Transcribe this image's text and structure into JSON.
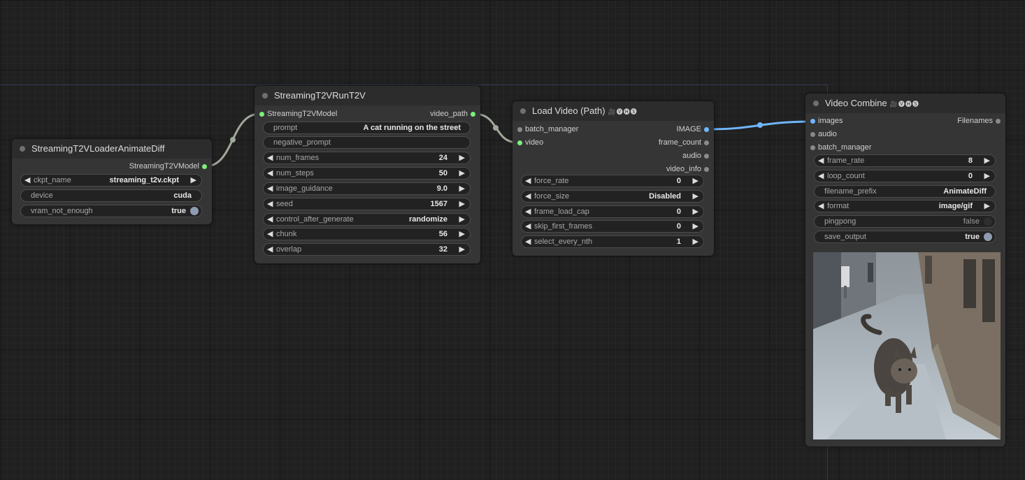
{
  "colors": {
    "link_green": "#a0a89a",
    "link_blue": "#6fb7ff",
    "slot_green": "#7cf07c",
    "slot_blue": "#6fb7ff",
    "slot_grey": "#8a8a8a",
    "toggle_on": "#8e9bb0"
  },
  "loader": {
    "title": "StreamingT2VLoaderAnimateDiff",
    "output": "StreamingT2VModel",
    "widgets": [
      {
        "name": "ckpt_name",
        "value": "streaming_t2v.ckpt"
      },
      {
        "name": "device",
        "value": "cuda"
      },
      {
        "name": "vram_not_enough",
        "value": "true"
      }
    ]
  },
  "run": {
    "title": "StreamingT2VRunT2V",
    "input": "StreamingT2VModel",
    "output": "video_path",
    "widgets": [
      {
        "name": "prompt",
        "value": "A cat running on the street"
      },
      {
        "name": "negative_prompt",
        "value": ""
      },
      {
        "name": "num_frames",
        "value": "24"
      },
      {
        "name": "num_steps",
        "value": "50"
      },
      {
        "name": "image_guidance",
        "value": "9.0"
      },
      {
        "name": "seed",
        "value": "1567"
      },
      {
        "name": "control_after_generate",
        "value": "randomize"
      },
      {
        "name": "chunk",
        "value": "56"
      },
      {
        "name": "overlap",
        "value": "32"
      }
    ]
  },
  "load": {
    "title": "Load Video (Path)",
    "badge": "🎥🅥🅗🅢",
    "inputs": [
      "batch_manager",
      "video"
    ],
    "outputs": [
      "IMAGE",
      "frame_count",
      "audio",
      "video_info"
    ],
    "widgets": [
      {
        "name": "force_rate",
        "value": "0"
      },
      {
        "name": "force_size",
        "value": "Disabled"
      },
      {
        "name": "frame_load_cap",
        "value": "0"
      },
      {
        "name": "skip_first_frames",
        "value": "0"
      },
      {
        "name": "select_every_nth",
        "value": "1"
      }
    ]
  },
  "combine": {
    "title": "Video Combine",
    "badge": "🎥🅥🅗🅢",
    "inputs": [
      "images",
      "audio",
      "batch_manager"
    ],
    "output": "Filenames",
    "widgets": [
      {
        "name": "frame_rate",
        "value": "8"
      },
      {
        "name": "loop_count",
        "value": "0"
      },
      {
        "name": "filename_prefix",
        "value": "AnimateDiff"
      },
      {
        "name": "format",
        "value": "image/gif"
      },
      {
        "name": "pingpong",
        "value": "false"
      },
      {
        "name": "save_output",
        "value": "true"
      }
    ]
  },
  "arrows": {
    "left": "◀",
    "right": "▶"
  }
}
